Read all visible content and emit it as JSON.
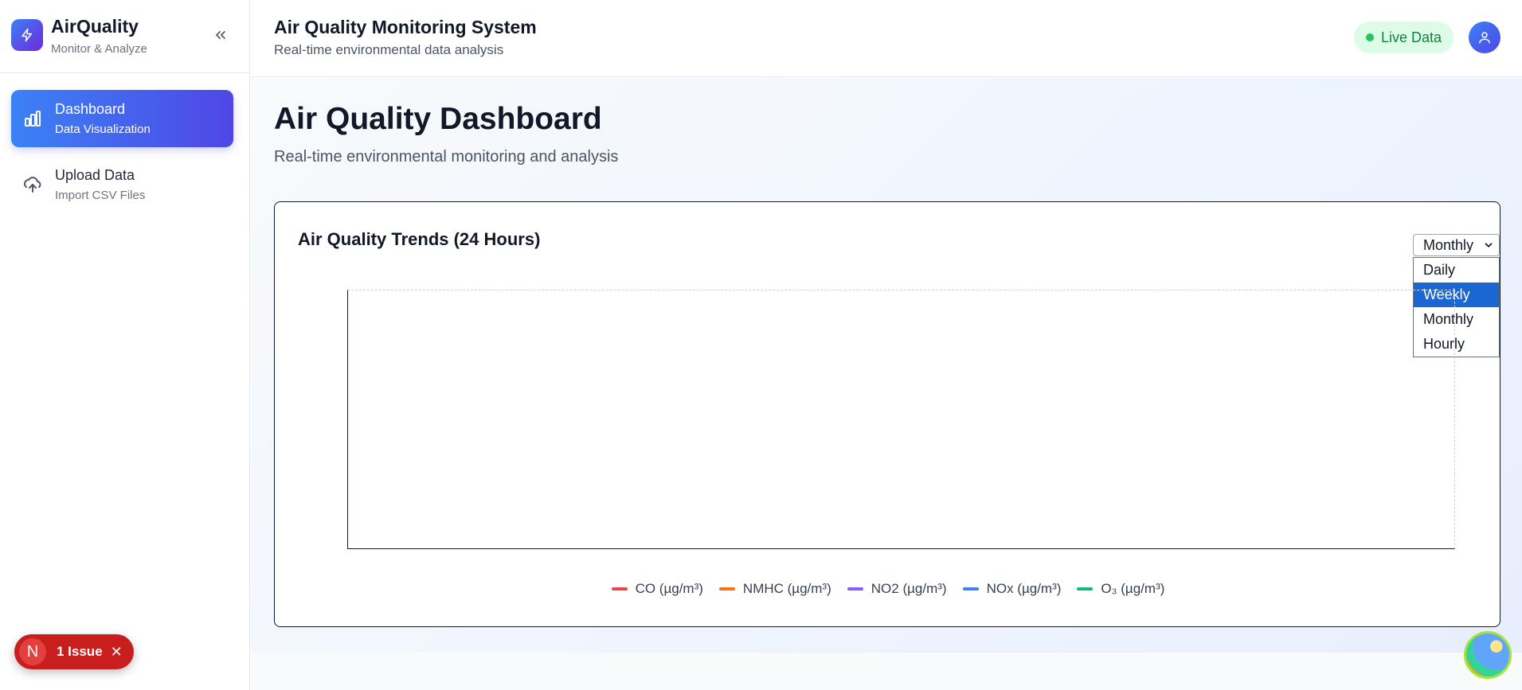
{
  "sidebar": {
    "brand_title": "AirQuality",
    "brand_subtitle": "Monitor & Analyze",
    "items": [
      {
        "label": "Dashboard",
        "sub": "Data Visualization",
        "icon": "bar-chart-icon",
        "active": true
      },
      {
        "label": "Upload Data",
        "sub": "Import CSV Files",
        "icon": "cloud-upload-icon",
        "active": false
      }
    ]
  },
  "header": {
    "title": "Air Quality Monitoring System",
    "subtitle": "Real-time environmental data analysis",
    "live_label": "Live Data"
  },
  "page": {
    "title": "Air Quality Dashboard",
    "subtitle": "Real-time environmental monitoring and analysis"
  },
  "chart_card": {
    "title": "Air Quality Trends (24 Hours)",
    "select_value": "Monthly",
    "options": [
      "Daily",
      "Weekly",
      "Monthly",
      "Hourly"
    ],
    "highlighted_option": "Weekly"
  },
  "chart_data": {
    "type": "line",
    "title": "Air Quality Trends (24 Hours)",
    "x": [],
    "series": [
      {
        "name": "CO (µg/m³)",
        "color": "#ef4444",
        "values": []
      },
      {
        "name": "NMHC (µg/m³)",
        "color": "#f97316",
        "values": []
      },
      {
        "name": "NO2 (µg/m³)",
        "color": "#8b5cf6",
        "values": []
      },
      {
        "name": "NOx (µg/m³)",
        "color": "#3b82f6",
        "values": []
      },
      {
        "name": "O₃ (µg/m³)",
        "color": "#10b981",
        "values": []
      }
    ],
    "grid": false,
    "legend_position": "bottom-center"
  },
  "issue_badge": {
    "letter": "N",
    "label": "1 Issue"
  },
  "colors": {
    "accent": "#4f46e5",
    "live_green": "#22c55e",
    "issue_red": "#c81e1e"
  }
}
